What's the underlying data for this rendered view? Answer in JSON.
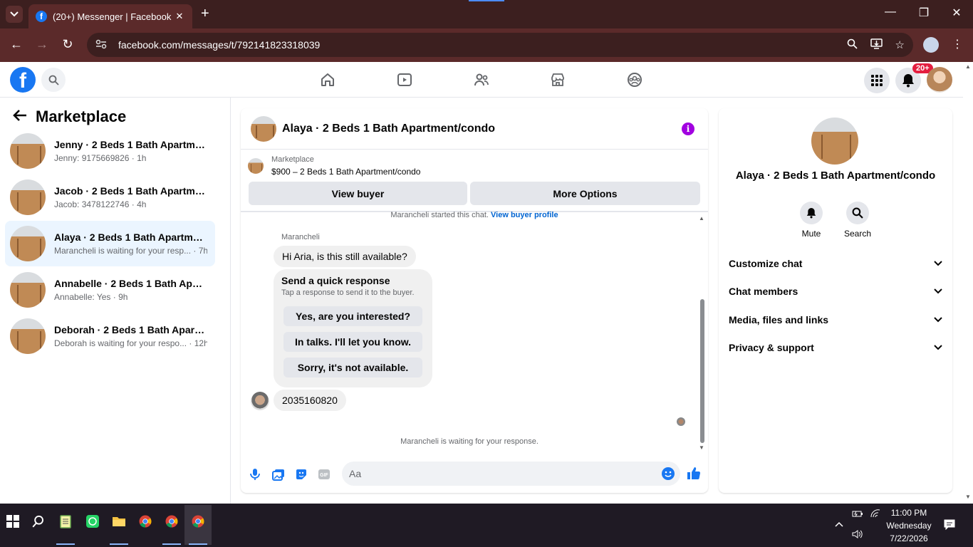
{
  "browser": {
    "tab_title": "(20+) Messenger | Facebook",
    "tab_favicon": "f",
    "url": "facebook.com/messages/t/792141823318039"
  },
  "fb": {
    "notification_badge": "20+"
  },
  "sidebar": {
    "title": "Marketplace",
    "conversations": [
      {
        "name": "Jenny · 2 Beds 1 Bath Apartment...",
        "sub": "Jenny: 9175669826 · 1h"
      },
      {
        "name": "Jacob · 2 Beds 1 Bath Apartment...",
        "sub": "Jacob: 3478122746 · 4h"
      },
      {
        "name": "Alaya · 2 Beds 1 Bath Apartment...",
        "sub": "Marancheli is waiting for your resp... · 7h"
      },
      {
        "name": "Annabelle · 2 Beds 1 Bath Apart...",
        "sub": "Annabelle: Yes · 9h"
      },
      {
        "name": "Deborah · 2 Beds 1 Bath Apartm...",
        "sub": "Deborah is waiting for your respo... · 12h"
      }
    ]
  },
  "chat": {
    "title": "Alaya · 2 Beds 1 Bath Apartment/condo",
    "marketplace_label": "Marketplace",
    "listing": "$900 – 2 Beds 1 Bath Apartment/condo",
    "view_buyer_label": "View buyer",
    "more_options_label": "More Options",
    "started_text": "Marancheli started this chat.",
    "view_buyer_profile": "View buyer profile",
    "sender": "Marancheli",
    "message1": "Hi Aria, is this still available?",
    "quick_title": "Send a quick response",
    "quick_sub": "Tap a response to send it to the buyer.",
    "quick_options": [
      "Yes, are you interested?",
      "In talks. I'll let you know.",
      "Sorry, it's not available."
    ],
    "message2": "2035160820",
    "waiting": "Marancheli is waiting for your response.",
    "composer_placeholder": "Aa"
  },
  "right_panel": {
    "name": "Alaya · 2 Beds 1 Bath Apartment/condo",
    "mute_label": "Mute",
    "search_label": "Search",
    "sections": [
      "Customize chat",
      "Chat members",
      "Media, files and links",
      "Privacy & support"
    ]
  },
  "taskbar": {
    "time": "11:00 PM",
    "day": "Wednesday",
    "date": "7/22/2026"
  },
  "colors": {
    "chrome_dark": "#3c1f1f",
    "chrome_bar": "#5b2a2a",
    "fb_blue": "#1877f2",
    "active_row": "#ebf5ff",
    "info_purple": "#a100e0"
  }
}
